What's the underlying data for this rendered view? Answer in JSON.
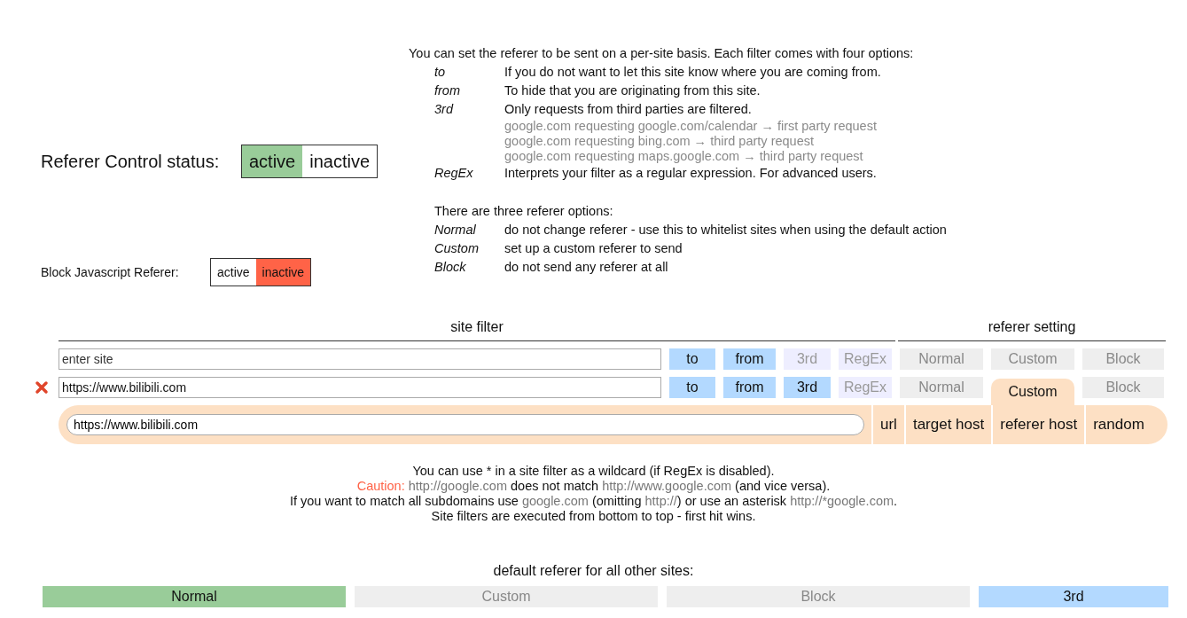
{
  "status": {
    "label": "Referer Control status:",
    "options": [
      {
        "label": "active",
        "selected": true
      },
      {
        "label": "inactive",
        "selected": false
      }
    ]
  },
  "block_js": {
    "label": "Block Javascript Referer:",
    "options": [
      {
        "label": "active",
        "selected": false
      },
      {
        "label": "inactive",
        "selected": true
      }
    ]
  },
  "help": {
    "intro": "You can set the referer to be sent on a per-site basis. Each filter comes with four options:",
    "filter_options": [
      {
        "term": "to",
        "text": "If you do not want to let this site know where you are coming from."
      },
      {
        "term": "from",
        "text": "To hide that you are originating from this site."
      },
      {
        "term": "3rd",
        "text": "Only requests from third parties are filtered.",
        "examples": [
          "google.com requesting google.com/calendar → first party request",
          "google.com requesting bing.com → third party request",
          "google.com requesting maps.google.com → third party request"
        ]
      },
      {
        "term": "RegEx",
        "text": "Interprets your filter as a regular expression. For advanced users."
      }
    ],
    "referer_intro": "There are three referer options:",
    "referer_options": [
      {
        "term": "Normal",
        "text": "do not change referer - use this to whitelist sites when using the default action"
      },
      {
        "term": "Custom",
        "text": "set up a custom referer to send"
      },
      {
        "term": "Block",
        "text": "do not send any referer at all"
      }
    ]
  },
  "table": {
    "site_header": "site filter",
    "referer_header": "referer setting",
    "rows": [
      {
        "removable": false,
        "placeholder": "enter site",
        "value": "",
        "filters": [
          {
            "label": "to",
            "on": true
          },
          {
            "label": "from",
            "on": true
          },
          {
            "label": "3rd",
            "on": false
          },
          {
            "label": "RegEx",
            "on": false
          }
        ],
        "referer": [
          {
            "label": "Normal",
            "selected": false
          },
          {
            "label": "Custom",
            "selected": false
          },
          {
            "label": "Block",
            "selected": false
          }
        ]
      },
      {
        "removable": true,
        "value": "https://www.bilibili.com",
        "filters": [
          {
            "label": "to",
            "on": true
          },
          {
            "label": "from",
            "on": true
          },
          {
            "label": "3rd",
            "on": true
          },
          {
            "label": "RegEx",
            "on": false
          }
        ],
        "referer": [
          {
            "label": "Normal",
            "selected": false
          },
          {
            "label": "Custom",
            "selected": true
          },
          {
            "label": "Block",
            "selected": false
          }
        ],
        "custom": {
          "value": "https://www.bilibili.com",
          "buttons": [
            "url",
            "target host",
            "referer host",
            "random"
          ]
        }
      }
    ]
  },
  "notes": [
    [
      {
        "kind": "plain",
        "text": "You can use * in a site filter as a wildcard (if RegEx is disabled)."
      }
    ],
    [
      {
        "kind": "caution",
        "text": "Caution: "
      },
      {
        "kind": "link",
        "text": "http://google.com"
      },
      {
        "kind": "plain",
        "text": " does not match "
      },
      {
        "kind": "link",
        "text": "http://www.google.com"
      },
      {
        "kind": "plain",
        "text": " (and vice versa)."
      }
    ],
    [
      {
        "kind": "plain",
        "text": "If you want to match all subdomains use "
      },
      {
        "kind": "link",
        "text": "google.com"
      },
      {
        "kind": "plain",
        "text": " (omitting "
      },
      {
        "kind": "link",
        "text": "http://"
      },
      {
        "kind": "plain",
        "text": ") or use an asterisk "
      },
      {
        "kind": "link",
        "text": "http://*google.com"
      },
      {
        "kind": "plain",
        "text": "."
      }
    ],
    [
      {
        "kind": "plain",
        "text": "Site filters are executed from bottom to top - first hit wins."
      }
    ]
  ],
  "default": {
    "title": "default referer for all other sites:",
    "options": [
      {
        "kind": "referer",
        "label": "Normal",
        "selected": true
      },
      {
        "kind": "referer",
        "label": "Custom",
        "selected": false
      },
      {
        "kind": "referer",
        "label": "Block",
        "selected": false
      },
      {
        "kind": "filter",
        "label": "3rd",
        "on": true
      }
    ]
  }
}
